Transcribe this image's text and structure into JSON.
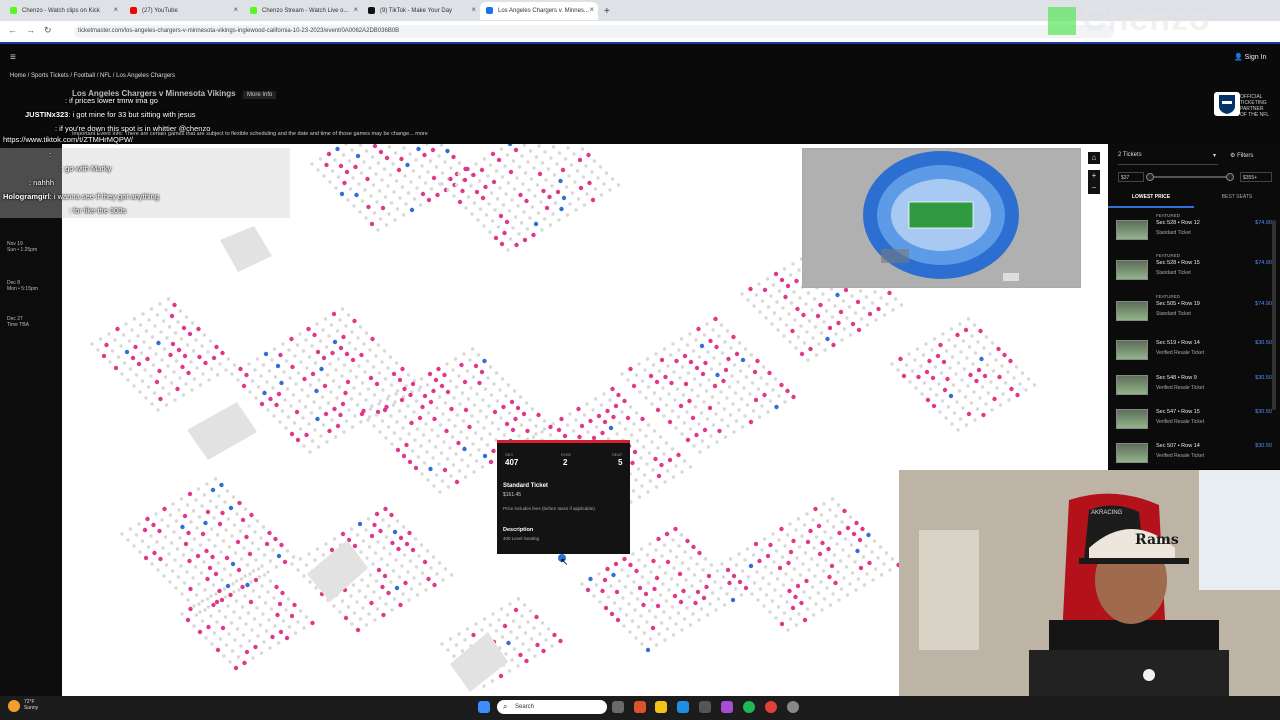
{
  "browser": {
    "tabs": [
      {
        "label": "Chenzo - Watch clips on Kick",
        "color": "#53fc18"
      },
      {
        "label": "(27) YouTube",
        "color": "#ff0000"
      },
      {
        "label": "Chenzo Stream - Watch Live o...",
        "color": "#53fc18"
      },
      {
        "label": "(9) TikTok - Make Your Day",
        "color": "#111111"
      },
      {
        "label": "Los Angeles Chargers v. Minnes...",
        "color": "#1a73e8"
      }
    ],
    "url": "ticketmaster.com/los-angeles-chargers-v-minnesota-vikings-inglewood-california-10-23-2023/event/0A0062A2DB036B0B"
  },
  "site": {
    "breadcrumb": "Home / Sports Tickets / Football / NFL / Los Angeles Chargers",
    "sign_in": "Sign In",
    "event_title": "Los Angeles Chargers v Minnesota Vikings",
    "more_info": "More Info",
    "notice": "Important Event Info: There are certain games that are subject to flexible scheduling and the date and time of those games may be change... more",
    "official": "OFFICIAL TICKETING PARTNER OF THE NFL"
  },
  "chat": [
    {
      "user": "",
      "text": ": if prices lower tmrw ima go",
      "color": "red"
    },
    {
      "user": "JUSTINx323",
      "text": ": i got mine for 33 but sitting with jesus",
      "color": "white"
    },
    {
      "user": "",
      "text": ": if you're down this spot is in whittier @chenzo",
      "color": "red"
    },
    {
      "user": "",
      "text": "https://www.tiktok.com/t/ZTMHrMQPW/",
      "color": "white"
    },
    {
      "user": "",
      "text": ":",
      "color": "purple"
    },
    {
      "user": "",
      "text": ": go with Marky",
      "color": "red"
    },
    {
      "user": "",
      "text": ": nahhh",
      "color": "red"
    },
    {
      "user": "Hologramgirl",
      "text": ": i wanna see if they got anything",
      "color": "white"
    },
    {
      "user": "",
      "text": ": for like the 300s",
      "color": "red"
    }
  ],
  "sidebar_dates": [
    {
      "label": "Nov 19",
      "sub": "Sun • 1:25pm"
    },
    {
      "label": "Dec 8",
      "sub": "Mon • 5:15pm"
    },
    {
      "label": "Dec 27",
      "sub": "Time TBA"
    }
  ],
  "tooltip": {
    "sec_label": "SEC",
    "sec": "407",
    "row_label": "ROW",
    "row": "2",
    "seat_label": "SEAT",
    "seat": "5",
    "ticket_type": "Standard Ticket",
    "price": "$161.45",
    "fees_note": "Price includes fees (before taxes if applicable).",
    "desc_label": "Description",
    "desc": "400 Level Seating"
  },
  "panel": {
    "tickets": "2 Tickets",
    "filters": "Filters",
    "min_price": "$37",
    "max_price": "$355+",
    "sort_tabs": [
      "LOWEST PRICE",
      "BEST SEATS"
    ],
    "listings": [
      {
        "featured": "FEATURED",
        "section": "Sec 528 • Row 12",
        "type": "Standard Ticket",
        "price": "$74.90"
      },
      {
        "featured": "FEATURED",
        "section": "Sec 528 • Row 15",
        "type": "Standard Ticket",
        "price": "$74.90"
      },
      {
        "featured": "FEATURED",
        "section": "Sec 505 • Row 19",
        "type": "Standard Ticket",
        "price": "$74.90"
      },
      {
        "featured": "",
        "section": "Sec 519 • Row 14",
        "type": "Verified Resale Ticket",
        "price": "$30.50"
      },
      {
        "featured": "",
        "section": "Sec 548 • Row 9",
        "type": "Verified Resale Ticket",
        "price": "$30.50"
      },
      {
        "featured": "",
        "section": "Sec 547 • Row 15",
        "type": "Verified Resale Ticket",
        "price": "$30.50"
      },
      {
        "featured": "",
        "section": "Sec 507 • Row 14",
        "type": "Verified Resale Ticket",
        "price": "$30.50"
      }
    ]
  },
  "stream": {
    "logo": "Chenzo",
    "hat_text": "Rams",
    "chair_brand": "AKRACING"
  },
  "taskbar": {
    "weather": "72°F",
    "weather_sub": "Sunny",
    "search_placeholder": "Search"
  },
  "colors": {
    "available_seat": "#e0368c",
    "aisle_seat": "#2f6fd6",
    "taken_seat": "#d8d8d8",
    "accent_red": "#d81e2b"
  }
}
